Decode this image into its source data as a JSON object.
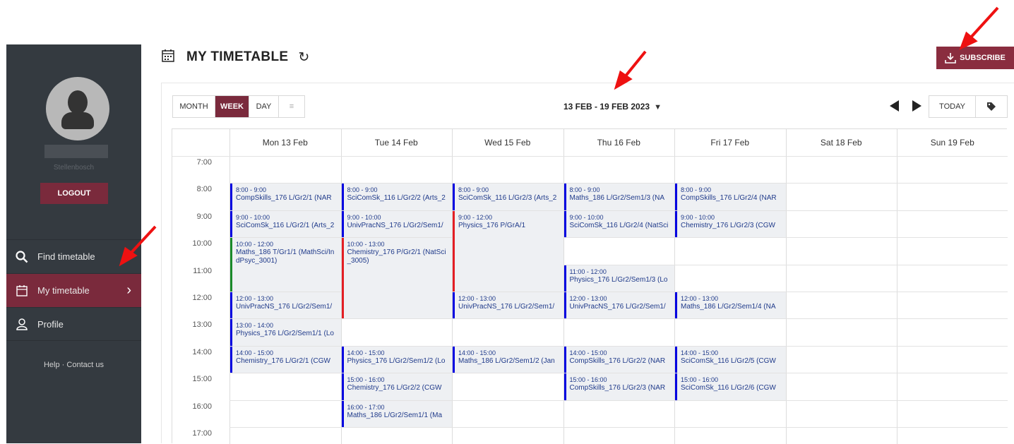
{
  "sidebar": {
    "campus": "Stellenbosch",
    "logout_label": "LOGOUT",
    "nav": [
      {
        "label": "Find timetable",
        "icon": "search-icon"
      },
      {
        "label": "My timetable",
        "icon": "calendar-icon"
      },
      {
        "label": "Profile",
        "icon": "user-icon"
      }
    ],
    "help_label": "Help",
    "contact_label": "Contact us"
  },
  "header": {
    "title": "MY TIMETABLE",
    "subscribe_label": "SUBSCRIBE"
  },
  "toolbar": {
    "views": [
      "MONTH",
      "WEEK",
      "DAY"
    ],
    "active_view": "WEEK",
    "date_range": "13 FEB - 19 FEB 2023",
    "today_label": "TODAY"
  },
  "days": [
    "Mon 13 Feb",
    "Tue 14 Feb",
    "Wed 15 Feb",
    "Thu 16 Feb",
    "Fri 17 Feb",
    "Sat 18 Feb",
    "Sun 19 Feb"
  ],
  "hours": [
    "7:00",
    "8:00",
    "9:00",
    "10:00",
    "11:00",
    "12:00",
    "13:00",
    "14:00",
    "15:00",
    "16:00",
    "17:00"
  ],
  "events": [
    {
      "day": 0,
      "start": 8,
      "end": 9,
      "time": "8:00 - 9:00",
      "desc": "CompSkills_176 L/Gr2/1 (NAR",
      "color": "blue"
    },
    {
      "day": 0,
      "start": 9,
      "end": 10,
      "time": "9:00 - 10:00",
      "desc": "SciComSk_116 L/Gr2/1 (Arts_2",
      "color": "blue"
    },
    {
      "day": 0,
      "start": 10,
      "end": 12,
      "time": "10:00 - 12:00",
      "desc": "Maths_186 T/Gr1/1 (MathSci/IndPsyc_3001)",
      "color": "green"
    },
    {
      "day": 0,
      "start": 12,
      "end": 13,
      "time": "12:00 - 13:00",
      "desc": "UnivPracNS_176 L/Gr2/Sem1/",
      "color": "blue"
    },
    {
      "day": 0,
      "start": 13,
      "end": 14,
      "time": "13:00 - 14:00",
      "desc": "Physics_176 L/Gr2/Sem1/1 (Lo",
      "color": "blue"
    },
    {
      "day": 0,
      "start": 14,
      "end": 15,
      "time": "14:00 - 15:00",
      "desc": "Chemistry_176 L/Gr2/1 (CGW",
      "color": "blue"
    },
    {
      "day": 1,
      "start": 8,
      "end": 9,
      "time": "8:00 - 9:00",
      "desc": "SciComSk_116 L/Gr2/2 (Arts_2",
      "color": "blue"
    },
    {
      "day": 1,
      "start": 9,
      "end": 10,
      "time": "9:00 - 10:00",
      "desc": "UnivPracNS_176 L/Gr2/Sem1/",
      "color": "blue"
    },
    {
      "day": 1,
      "start": 10,
      "end": 13,
      "time": "10:00 - 13:00",
      "desc": "Chemistry_176 P/Gr2/1 (NatSci_3005)",
      "color": "red"
    },
    {
      "day": 1,
      "start": 14,
      "end": 15,
      "time": "14:00 - 15:00",
      "desc": "Physics_176 L/Gr2/Sem1/2 (Lo",
      "color": "blue"
    },
    {
      "day": 1,
      "start": 15,
      "end": 16,
      "time": "15:00 - 16:00",
      "desc": "Chemistry_176 L/Gr2/2 (CGW",
      "color": "blue"
    },
    {
      "day": 1,
      "start": 16,
      "end": 17,
      "time": "16:00 - 17:00",
      "desc": "Maths_186 L/Gr2/Sem1/1 (Ma",
      "color": "blue"
    },
    {
      "day": 2,
      "start": 8,
      "end": 9,
      "time": "8:00 - 9:00",
      "desc": "SciComSk_116 L/Gr2/3 (Arts_2",
      "color": "blue"
    },
    {
      "day": 2,
      "start": 9,
      "end": 12,
      "time": "9:00 - 12:00",
      "desc": "Physics_176 P/GrA/1",
      "color": "red"
    },
    {
      "day": 2,
      "start": 12,
      "end": 13,
      "time": "12:00 - 13:00",
      "desc": "UnivPracNS_176 L/Gr2/Sem1/",
      "color": "blue"
    },
    {
      "day": 2,
      "start": 14,
      "end": 15,
      "time": "14:00 - 15:00",
      "desc": "Maths_186 L/Gr2/Sem1/2 (Jan",
      "color": "blue"
    },
    {
      "day": 3,
      "start": 8,
      "end": 9,
      "time": "8:00 - 9:00",
      "desc": "Maths_186 L/Gr2/Sem1/3 (NA",
      "color": "blue"
    },
    {
      "day": 3,
      "start": 9,
      "end": 10,
      "time": "9:00 - 10:00",
      "desc": "SciComSk_116 L/Gr2/4 (NatSci",
      "color": "blue"
    },
    {
      "day": 3,
      "start": 11,
      "end": 12,
      "time": "11:00 - 12:00",
      "desc": "Physics_176 L/Gr2/Sem1/3 (Lo",
      "color": "blue"
    },
    {
      "day": 3,
      "start": 12,
      "end": 13,
      "time": "12:00 - 13:00",
      "desc": "UnivPracNS_176 L/Gr2/Sem1/",
      "color": "blue"
    },
    {
      "day": 3,
      "start": 14,
      "end": 15,
      "time": "14:00 - 15:00",
      "desc": "CompSkills_176 L/Gr2/2 (NAR",
      "color": "blue"
    },
    {
      "day": 3,
      "start": 15,
      "end": 16,
      "time": "15:00 - 16:00",
      "desc": "CompSkills_176 L/Gr2/3 (NAR",
      "color": "blue"
    },
    {
      "day": 4,
      "start": 8,
      "end": 9,
      "time": "8:00 - 9:00",
      "desc": "CompSkills_176 L/Gr2/4 (NAR",
      "color": "blue"
    },
    {
      "day": 4,
      "start": 9,
      "end": 10,
      "time": "9:00 - 10:00",
      "desc": "Chemistry_176 L/Gr2/3 (CGW",
      "color": "blue"
    },
    {
      "day": 4,
      "start": 12,
      "end": 13,
      "time": "12:00 - 13:00",
      "desc": "Maths_186 L/Gr2/Sem1/4 (NA",
      "color": "blue"
    },
    {
      "day": 4,
      "start": 14,
      "end": 15,
      "time": "14:00 - 15:00",
      "desc": "SciComSk_116 L/Gr2/5 (CGW",
      "color": "blue"
    },
    {
      "day": 4,
      "start": 15,
      "end": 16,
      "time": "15:00 - 16:00",
      "desc": "SciComSk_116 L/Gr2/6 (CGW",
      "color": "blue"
    }
  ],
  "colors": {
    "accent": "#7a2a3c",
    "sidebar": "#343a40",
    "event_blue": "#0000e0",
    "event_red": "#e31e24",
    "event_green": "#1a8a2a"
  }
}
